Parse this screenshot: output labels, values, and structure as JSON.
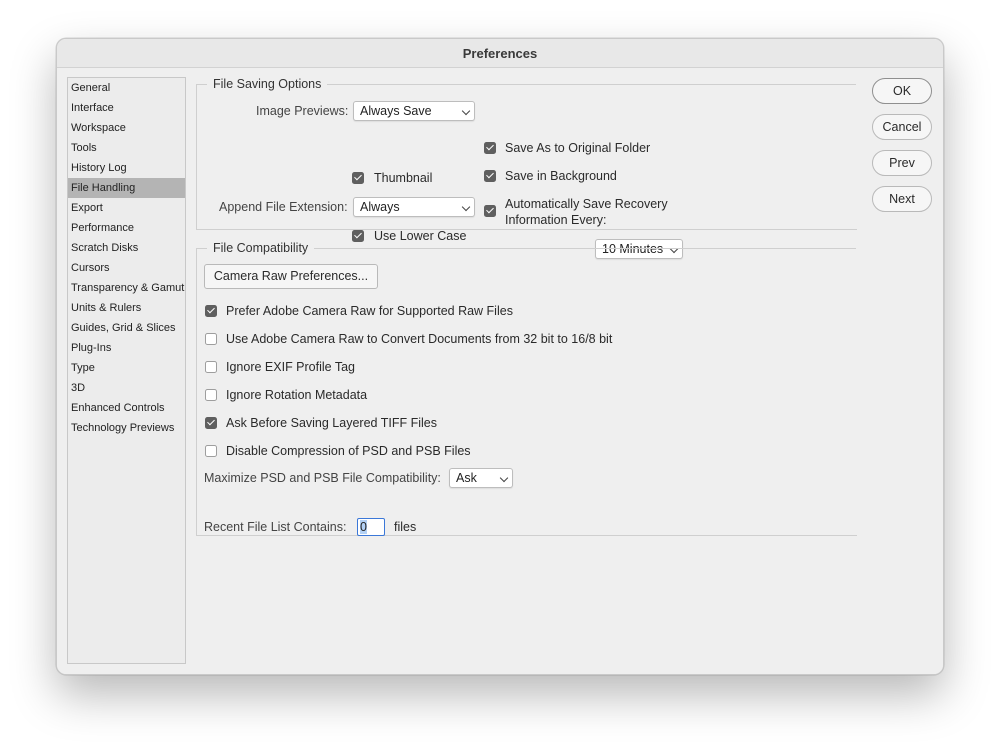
{
  "window": {
    "title": "Preferences"
  },
  "sidebar": {
    "items": [
      {
        "label": "General",
        "selected": false
      },
      {
        "label": "Interface",
        "selected": false
      },
      {
        "label": "Workspace",
        "selected": false
      },
      {
        "label": "Tools",
        "selected": false
      },
      {
        "label": "History Log",
        "selected": false
      },
      {
        "label": "File Handling",
        "selected": true
      },
      {
        "label": "Export",
        "selected": false
      },
      {
        "label": "Performance",
        "selected": false
      },
      {
        "label": "Scratch Disks",
        "selected": false
      },
      {
        "label": "Cursors",
        "selected": false
      },
      {
        "label": "Transparency & Gamut",
        "selected": false
      },
      {
        "label": "Units & Rulers",
        "selected": false
      },
      {
        "label": "Guides, Grid & Slices",
        "selected": false
      },
      {
        "label": "Plug-Ins",
        "selected": false
      },
      {
        "label": "Type",
        "selected": false
      },
      {
        "label": "3D",
        "selected": false
      },
      {
        "label": "Enhanced Controls",
        "selected": false
      },
      {
        "label": "Technology Previews",
        "selected": false
      }
    ]
  },
  "file_saving": {
    "legend": "File Saving Options",
    "image_previews_label": "Image Previews:",
    "image_previews_value": "Always Save",
    "thumbnail_label": "Thumbnail",
    "thumbnail_checked": true,
    "append_ext_label": "Append File Extension:",
    "append_ext_value": "Always",
    "lower_case_label": "Use Lower Case",
    "lower_case_checked": true,
    "save_original_label": "Save As to Original Folder",
    "save_original_checked": true,
    "save_background_label": "Save in Background",
    "save_background_checked": true,
    "auto_recovery_label_line1": "Automatically Save Recovery",
    "auto_recovery_label_line2": "Information Every:",
    "auto_recovery_checked": true,
    "recovery_interval_value": "10 Minutes"
  },
  "file_compat": {
    "legend": "File Compatibility",
    "camera_raw_button": "Camera Raw Preferences...",
    "options": [
      {
        "label": "Prefer Adobe Camera Raw for Supported Raw Files",
        "checked": true
      },
      {
        "label": "Use Adobe Camera Raw to Convert Documents from 32 bit to 16/8 bit",
        "checked": false
      },
      {
        "label": "Ignore EXIF Profile Tag",
        "checked": false
      },
      {
        "label": "Ignore Rotation Metadata",
        "checked": false
      },
      {
        "label": "Ask Before Saving Layered TIFF Files",
        "checked": true
      },
      {
        "label": "Disable Compression of PSD and PSB Files",
        "checked": false
      }
    ],
    "maximize_label": "Maximize PSD and PSB File Compatibility:",
    "maximize_value": "Ask"
  },
  "recent": {
    "label": "Recent File List Contains:",
    "value": "0",
    "suffix": "files"
  },
  "buttons": {
    "ok": "OK",
    "cancel": "Cancel",
    "prev": "Prev",
    "next": "Next"
  }
}
